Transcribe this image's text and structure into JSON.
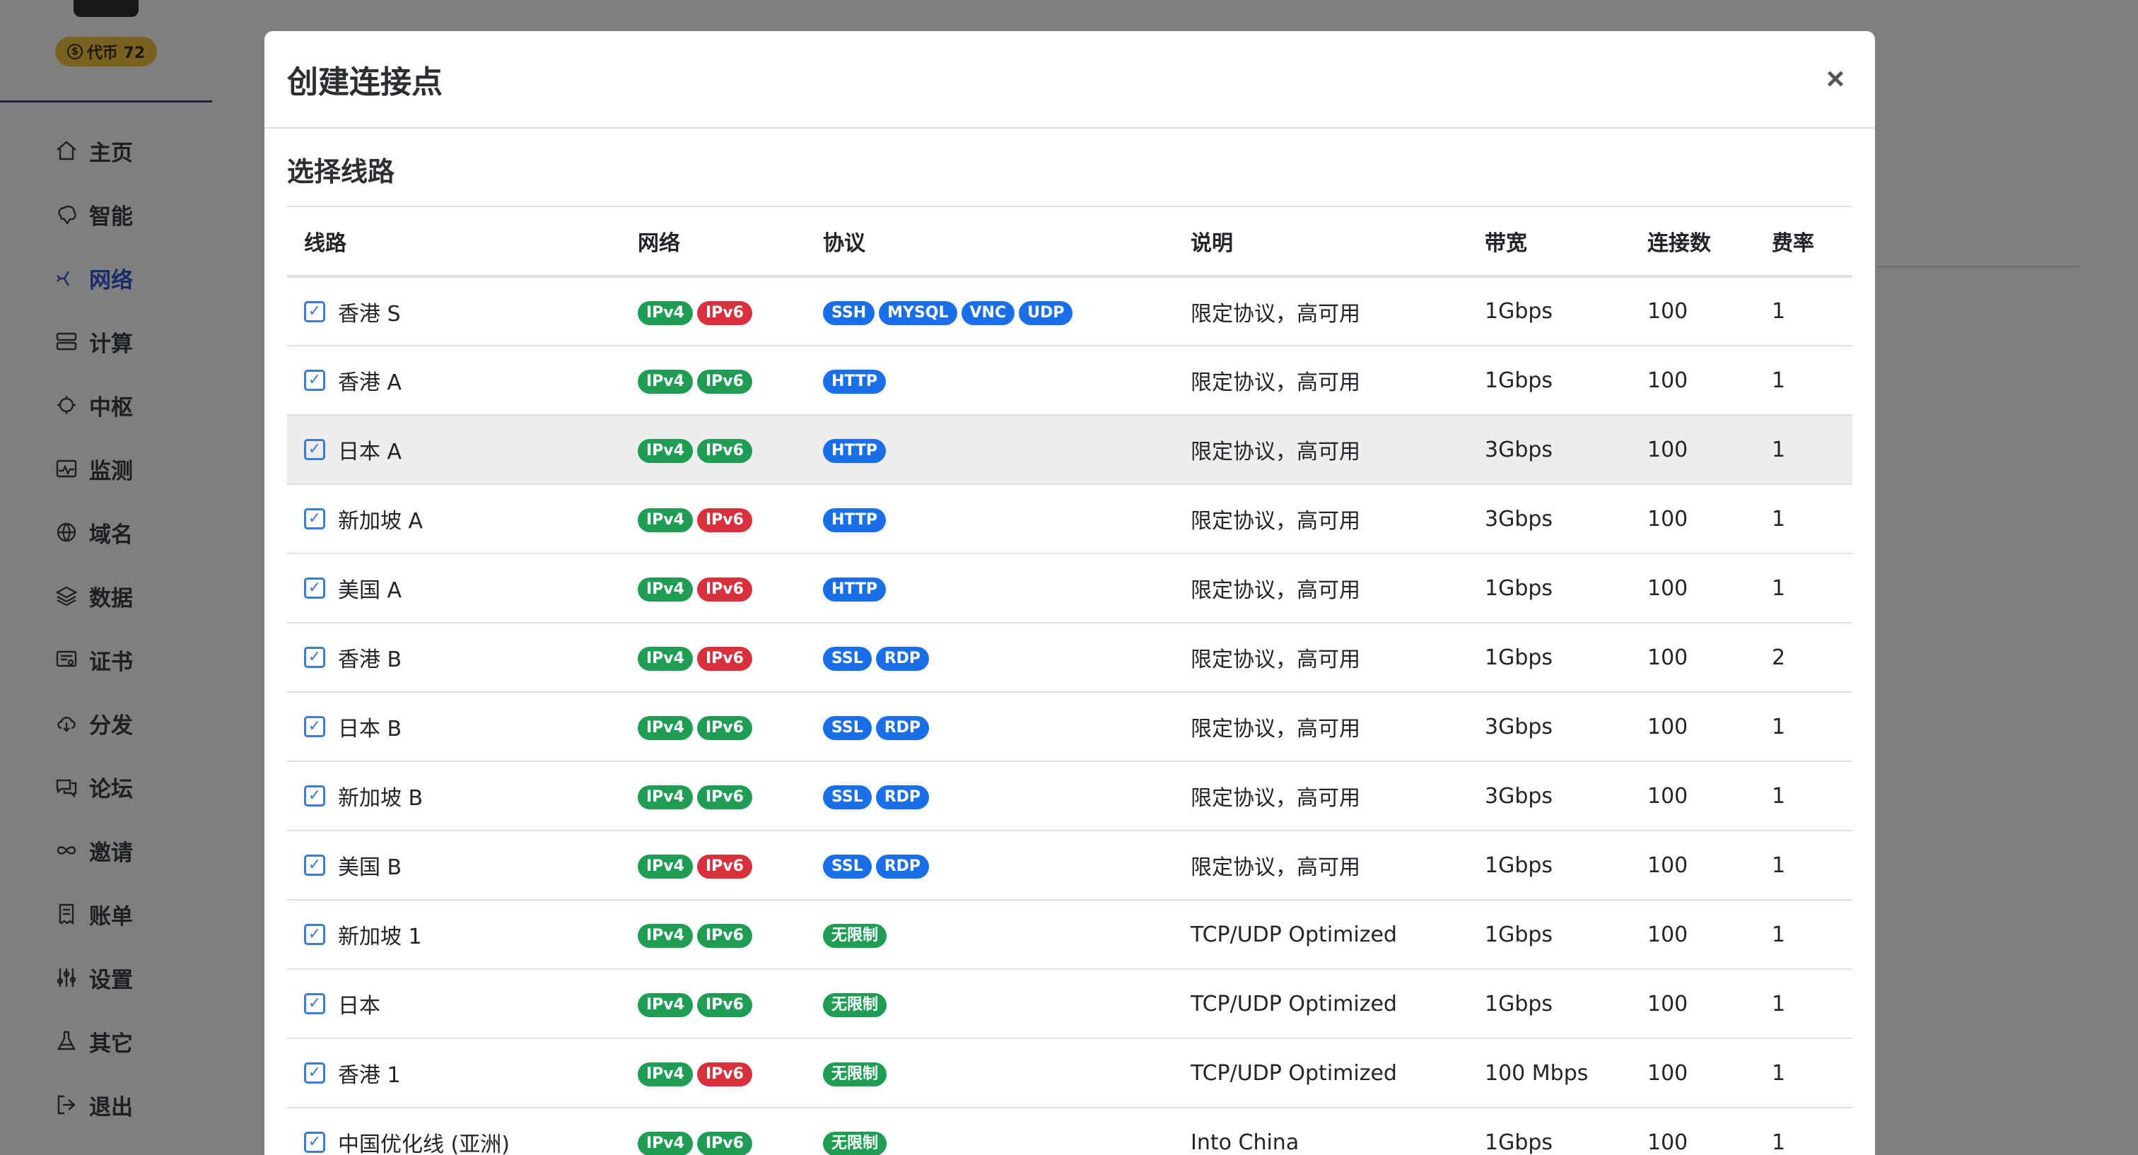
{
  "sidebar": {
    "coin_label": "代币 72",
    "coin_icon": "dollar-circle-icon",
    "items": [
      {
        "label": "主页",
        "icon": "home-icon"
      },
      {
        "label": "智能",
        "icon": "brain-icon"
      },
      {
        "label": "网络",
        "icon": "network-icon",
        "active": true
      },
      {
        "label": "计算",
        "icon": "server-icon"
      },
      {
        "label": "中枢",
        "icon": "hub-icon"
      },
      {
        "label": "监测",
        "icon": "monitor-icon"
      },
      {
        "label": "域名",
        "icon": "globe-icon"
      },
      {
        "label": "数据",
        "icon": "layers-icon"
      },
      {
        "label": "证书",
        "icon": "certificate-icon"
      },
      {
        "label": "分发",
        "icon": "cloud-download-icon"
      },
      {
        "label": "论坛",
        "icon": "chat-icon"
      },
      {
        "label": "邀请",
        "icon": "infinity-icon"
      },
      {
        "label": "账单",
        "icon": "receipt-icon"
      },
      {
        "label": "设置",
        "icon": "sliders-icon"
      },
      {
        "label": "其它",
        "icon": "flask-icon"
      },
      {
        "label": "退出",
        "icon": "logout-icon"
      }
    ]
  },
  "modal": {
    "title": "创建连接点",
    "close_label": "×",
    "section_title": "选择线路",
    "columns": [
      "线路",
      "网络",
      "协议",
      "说明",
      "带宽",
      "连接数",
      "费率"
    ],
    "rows": [
      {
        "route": "香港 S",
        "net": [
          [
            "IPv4",
            "green"
          ],
          [
            "IPv6",
            "red"
          ]
        ],
        "proto": [
          [
            "SSH",
            "blue"
          ],
          [
            "MYSQL",
            "blue"
          ],
          [
            "VNC",
            "blue"
          ],
          [
            "UDP",
            "blue"
          ]
        ],
        "desc": "限定协议，高可用",
        "bw": "1Gbps",
        "conn": "100",
        "rate": "1"
      },
      {
        "route": "香港 A",
        "net": [
          [
            "IPv4",
            "green"
          ],
          [
            "IPv6",
            "green"
          ]
        ],
        "proto": [
          [
            "HTTP",
            "blue"
          ]
        ],
        "desc": "限定协议，高可用",
        "bw": "1Gbps",
        "conn": "100",
        "rate": "1"
      },
      {
        "route": "日本 A",
        "net": [
          [
            "IPv4",
            "green"
          ],
          [
            "IPv6",
            "green"
          ]
        ],
        "proto": [
          [
            "HTTP",
            "blue"
          ]
        ],
        "desc": "限定协议，高可用",
        "bw": "3Gbps",
        "conn": "100",
        "rate": "1",
        "hover": true
      },
      {
        "route": "新加坡 A",
        "net": [
          [
            "IPv4",
            "green"
          ],
          [
            "IPv6",
            "red"
          ]
        ],
        "proto": [
          [
            "HTTP",
            "blue"
          ]
        ],
        "desc": "限定协议，高可用",
        "bw": "3Gbps",
        "conn": "100",
        "rate": "1"
      },
      {
        "route": "美国 A",
        "net": [
          [
            "IPv4",
            "green"
          ],
          [
            "IPv6",
            "red"
          ]
        ],
        "proto": [
          [
            "HTTP",
            "blue"
          ]
        ],
        "desc": "限定协议，高可用",
        "bw": "1Gbps",
        "conn": "100",
        "rate": "1"
      },
      {
        "route": "香港 B",
        "net": [
          [
            "IPv4",
            "green"
          ],
          [
            "IPv6",
            "red"
          ]
        ],
        "proto": [
          [
            "SSL",
            "blue"
          ],
          [
            "RDP",
            "blue"
          ]
        ],
        "desc": "限定协议，高可用",
        "bw": "1Gbps",
        "conn": "100",
        "rate": "2"
      },
      {
        "route": "日本 B",
        "net": [
          [
            "IPv4",
            "green"
          ],
          [
            "IPv6",
            "green"
          ]
        ],
        "proto": [
          [
            "SSL",
            "blue"
          ],
          [
            "RDP",
            "blue"
          ]
        ],
        "desc": "限定协议，高可用",
        "bw": "3Gbps",
        "conn": "100",
        "rate": "1"
      },
      {
        "route": "新加坡 B",
        "net": [
          [
            "IPv4",
            "green"
          ],
          [
            "IPv6",
            "green"
          ]
        ],
        "proto": [
          [
            "SSL",
            "blue"
          ],
          [
            "RDP",
            "blue"
          ]
        ],
        "desc": "限定协议，高可用",
        "bw": "3Gbps",
        "conn": "100",
        "rate": "1"
      },
      {
        "route": "美国 B",
        "net": [
          [
            "IPv4",
            "green"
          ],
          [
            "IPv6",
            "red"
          ]
        ],
        "proto": [
          [
            "SSL",
            "blue"
          ],
          [
            "RDP",
            "blue"
          ]
        ],
        "desc": "限定协议，高可用",
        "bw": "1Gbps",
        "conn": "100",
        "rate": "1"
      },
      {
        "route": "新加坡 1",
        "net": [
          [
            "IPv4",
            "green"
          ],
          [
            "IPv6",
            "green"
          ]
        ],
        "proto": [
          [
            "无限制",
            "green"
          ]
        ],
        "desc": "TCP/UDP Optimized",
        "bw": "1Gbps",
        "conn": "100",
        "rate": "1"
      },
      {
        "route": "日本",
        "net": [
          [
            "IPv4",
            "green"
          ],
          [
            "IPv6",
            "green"
          ]
        ],
        "proto": [
          [
            "无限制",
            "green"
          ]
        ],
        "desc": "TCP/UDP Optimized",
        "bw": "1Gbps",
        "conn": "100",
        "rate": "1"
      },
      {
        "route": "香港 1",
        "net": [
          [
            "IPv4",
            "green"
          ],
          [
            "IPv6",
            "red"
          ]
        ],
        "proto": [
          [
            "无限制",
            "green"
          ]
        ],
        "desc": "TCP/UDP Optimized",
        "bw": "100 Mbps",
        "conn": "100",
        "rate": "1"
      },
      {
        "route": "中国优化线 (亚洲)",
        "net": [
          [
            "IPv4",
            "green"
          ],
          [
            "IPv6",
            "green"
          ]
        ],
        "proto": [
          [
            "无限制",
            "green"
          ]
        ],
        "desc": "Into China",
        "bw": "1Gbps",
        "conn": "100",
        "rate": "1"
      }
    ]
  },
  "colors": {
    "green": "#1f9d55",
    "red": "#d9303e",
    "blue": "#1a6fe8",
    "active_nav": "#3356d6"
  }
}
